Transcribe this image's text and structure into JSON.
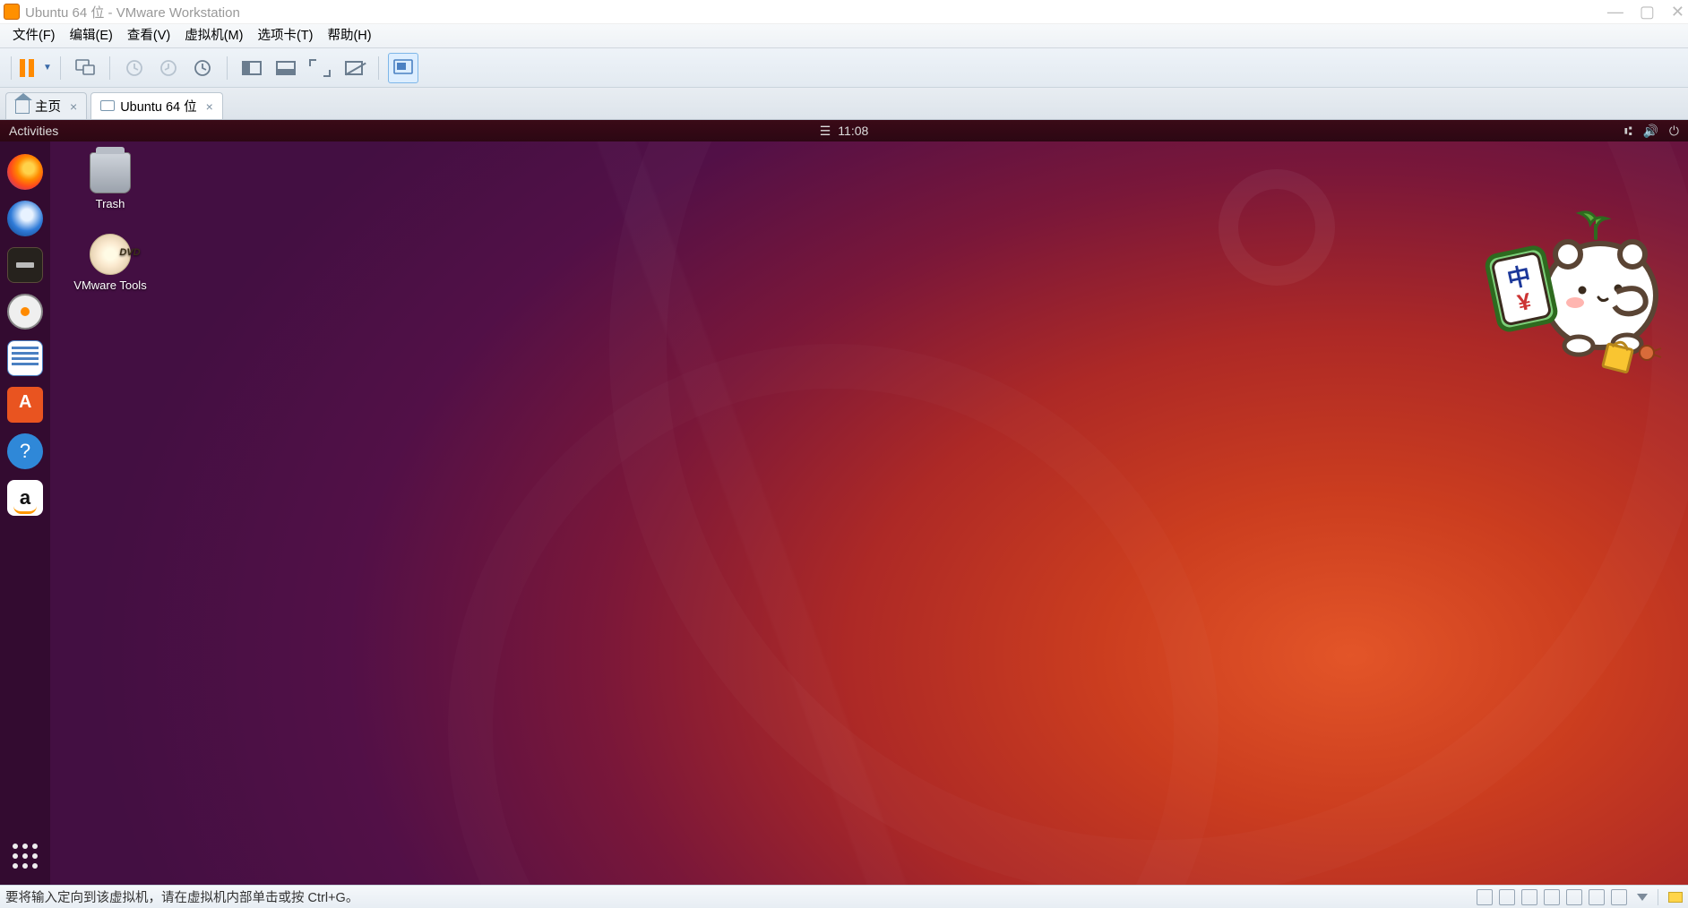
{
  "titlebar": {
    "title": "Ubuntu 64 位 - VMware Workstation"
  },
  "menu": {
    "file": "文件(F)",
    "edit": "编辑(E)",
    "view": "查看(V)",
    "vm": "虚拟机(M)",
    "tabs": "选项卡(T)",
    "help": "帮助(H)"
  },
  "tabs": {
    "home": "主页",
    "vm": "Ubuntu 64 位"
  },
  "gnome": {
    "activities": "Activities",
    "time": "11:08"
  },
  "desktop_icons": {
    "trash": "Trash",
    "vmtools": "VMware Tools"
  },
  "dock": {
    "items": [
      {
        "name": "firefox",
        "label": "Firefox"
      },
      {
        "name": "thunderbird",
        "label": "Thunderbird"
      },
      {
        "name": "files",
        "label": "Files"
      },
      {
        "name": "disk",
        "label": "External Drive"
      },
      {
        "name": "writer",
        "label": "LibreOffice Writer"
      },
      {
        "name": "software",
        "label": "Ubuntu Software"
      },
      {
        "name": "help",
        "label": "Help"
      },
      {
        "name": "amazon",
        "label": "Amazon"
      }
    ]
  },
  "footer": {
    "msg": "要将输入定向到该虚拟机，请在虚拟机内部单击或按 Ctrl+G。"
  }
}
